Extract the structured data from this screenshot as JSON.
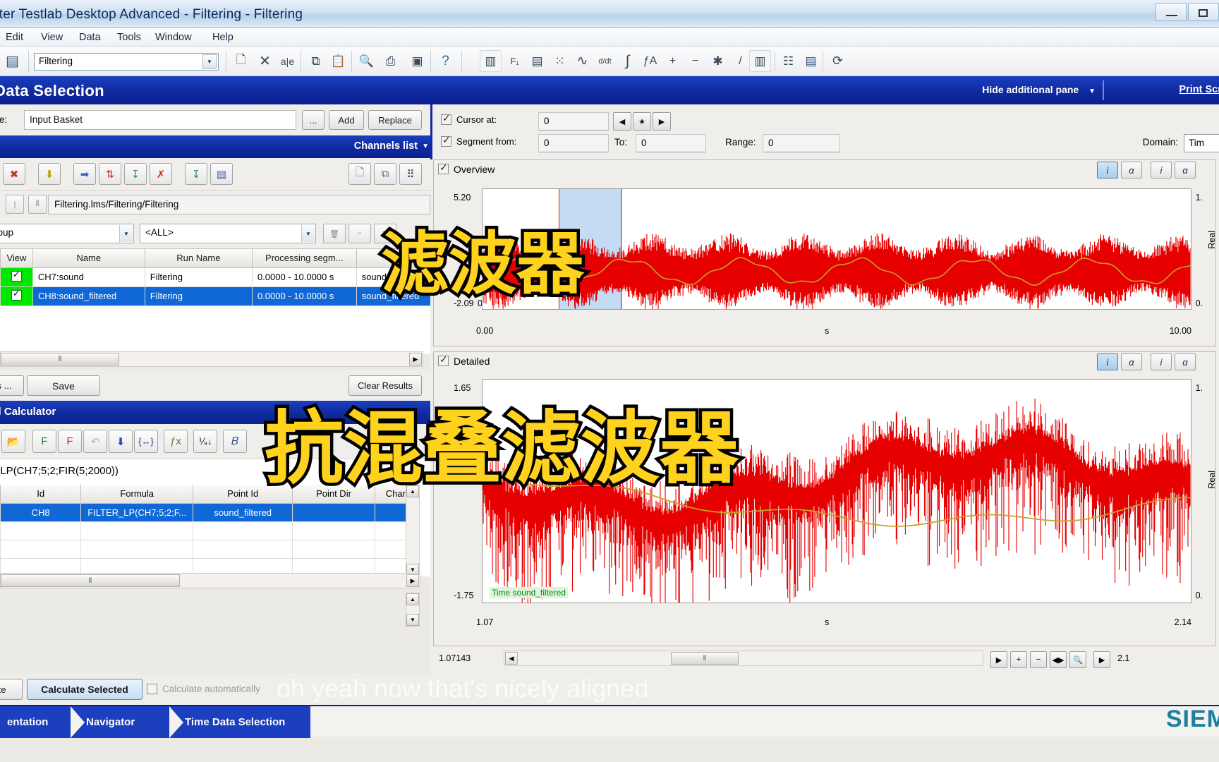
{
  "window": {
    "title": "nter Testlab Desktop Advanced - Filtering - Filtering",
    "minimize": "—",
    "restore": "❐"
  },
  "menu": {
    "items": [
      "Edit",
      "View",
      "Data",
      "Tools",
      "Window",
      "Help"
    ]
  },
  "toolbar": {
    "project_combo_value": "Filtering",
    "icons": [
      {
        "name": "save-icon",
        "glyph": "💾"
      },
      {
        "name": "new-document-icon",
        "glyph": "📄"
      },
      {
        "name": "delete-x-icon",
        "glyph": "✕"
      },
      {
        "name": "rename-icon",
        "glyph": "a|e"
      },
      {
        "name": "copy-icon",
        "glyph": "⧉"
      },
      {
        "name": "paste-icon",
        "glyph": "📋"
      },
      {
        "name": "print-preview-icon",
        "glyph": "🔍"
      },
      {
        "name": "print-icon",
        "glyph": "⎙"
      },
      {
        "name": "layout-icon",
        "glyph": "▣"
      },
      {
        "name": "help-icon",
        "glyph": "?"
      },
      {
        "name": "fft-icon",
        "glyph": "⬚"
      },
      {
        "name": "frf-icon",
        "glyph": "F₁"
      },
      {
        "name": "octave-icon",
        "glyph": "▒"
      },
      {
        "name": "scatter-icon",
        "glyph": "∷"
      },
      {
        "name": "waveform-icon",
        "glyph": "∿"
      },
      {
        "name": "derivative-icon",
        "glyph": "d/dt"
      },
      {
        "name": "integral-icon",
        "glyph": "∫"
      },
      {
        "name": "function-icon",
        "glyph": "ƒA"
      },
      {
        "name": "plus-icon",
        "glyph": "+"
      },
      {
        "name": "minus-icon",
        "glyph": "−"
      },
      {
        "name": "asterisk-icon",
        "glyph": "✱"
      },
      {
        "name": "divide-icon",
        "glyph": "/"
      },
      {
        "name": "srs-icon",
        "glyph": "⬚"
      },
      {
        "name": "report-icon",
        "glyph": "☷"
      },
      {
        "name": "save-report-icon",
        "glyph": "💾"
      },
      {
        "name": "browser-icon",
        "glyph": "⟳"
      }
    ]
  },
  "data_selection": {
    "title": "Data Selection",
    "hide_pane_label": "Hide additional pane",
    "print_screen_label": "Print Scree",
    "source_label": "ce:",
    "source_value": "Input Basket",
    "ellipsis_label": "...",
    "add_label": "Add",
    "replace_label": "Replace"
  },
  "cursor_panel": {
    "cursor_label": "Cursor at:",
    "cursor_value": "0",
    "segment_label": "Segment from:",
    "segment_from": "0",
    "to_label": "To:",
    "to_value": "0",
    "range_label": "Range:",
    "range_value": "0",
    "prev_icon": "◀",
    "center_icon": "★",
    "next_icon": "▶",
    "domain_label": "Domain:",
    "domain_value": "Tim"
  },
  "channels": {
    "header": "Channels list",
    "path_value": "Filtering.lms/Filtering/Filtering",
    "group_value": "roup",
    "all_value": "<ALL>",
    "toolbar_icons": [
      {
        "name": "remove-channel-icon",
        "glyph": "✖"
      },
      {
        "name": "import-down-icon",
        "glyph": "↓"
      },
      {
        "name": "move-right-icon",
        "glyph": "➡"
      },
      {
        "name": "swap-icon",
        "glyph": "⇅"
      },
      {
        "name": "add-to-display-icon",
        "glyph": "↧"
      },
      {
        "name": "remove-display-icon",
        "glyph": "✗"
      },
      {
        "name": "insert-icon",
        "glyph": "↧"
      },
      {
        "name": "save-channels-icon",
        "glyph": "💾"
      },
      {
        "name": "copy-list-icon",
        "glyph": "📄"
      },
      {
        "name": "duplicate-icon",
        "glyph": "⧉"
      },
      {
        "name": "grid-view-icon",
        "glyph": "∷"
      }
    ],
    "columns": [
      "View",
      "Name",
      "Run Name",
      "Processing segm...",
      "DOF id"
    ],
    "rows": [
      {
        "view": "✓",
        "name": "CH7:sound",
        "run": "Filtering",
        "segment": "0.0000 - 10.0000 s",
        "dof": "sound"
      },
      {
        "view": "✓",
        "name": "CH8:sound_filtered",
        "run": "Filtering",
        "segment": "0.0000 - 10.0000 s",
        "dof": "sound_filtered"
      }
    ]
  },
  "save_bar": {
    "save_as_label": "s ...",
    "save_label": "Save",
    "clear_results_label": "Clear Results"
  },
  "calculator": {
    "header": "nal Calculator",
    "formula_text": "_LP(CH7;5;2;FIR(5;2000))",
    "toolbar_icons": [
      {
        "name": "open-folder-icon",
        "glyph": "📂"
      },
      {
        "name": "new-formula-icon",
        "glyph": "F"
      },
      {
        "name": "delete-formula-icon",
        "glyph": "F"
      },
      {
        "name": "undo-icon",
        "glyph": "↶"
      },
      {
        "name": "apply-down-icon",
        "glyph": "↓"
      },
      {
        "name": "braces-icon",
        "glyph": "{↔}"
      },
      {
        "name": "fx-function-icon",
        "glyph": "ƒx"
      },
      {
        "name": "sort-icon",
        "glyph": "↓"
      },
      {
        "name": "bold-b-icon",
        "glyph": "𝑩"
      }
    ],
    "columns": [
      "Id",
      "Formula",
      "Point Id",
      "Point Dir",
      "Chan"
    ],
    "rows": [
      {
        "id": "CH8",
        "formula": "FILTER_LP(CH7;5;2;F...",
        "point_id": "sound_filtered",
        "point_dir": "",
        "chan": ""
      }
    ]
  },
  "action_bar": {
    "calculate_label": "te",
    "calculate_selected_label": "Calculate Selected",
    "auto_label": "Calculate automatically"
  },
  "nav_bar": {
    "items": [
      "entation",
      "Navigator",
      "Time Data Selection"
    ],
    "brand": "SIEM"
  },
  "overlay": {
    "caption_top": "滤波器",
    "caption_bottom": "抗混叠滤波器",
    "subtitle": "oh yeah now that's nicely aligned"
  },
  "chart_data": [
    {
      "type": "line",
      "name": "overview",
      "title": "Overview",
      "xlabel": "s",
      "ylabel": "Real",
      "xlim": [
        0.0,
        10.0
      ],
      "ylim": [
        -2.09,
        5.2
      ],
      "xticks": [
        "0.00",
        "10.00"
      ],
      "yticks": [
        "5.20",
        "-2.09"
      ],
      "x_origin_label": "0.00",
      "right_axis_ticks": [
        "1.",
        "0."
      ],
      "right_axis_label": "Real",
      "grid": false,
      "legend": "",
      "series": [
        {
          "name": "Time sound",
          "color": "#e60000",
          "description": "broadband noisy waveform, amplitude envelope ~ +/-1.6"
        },
        {
          "name": "Time sound_filtered",
          "color": "#c9a227",
          "description": "low-pass filtered sinusoid ~0.5 Hz, amplitude ~0.45"
        }
      ],
      "selection_band": [
        1.07,
        2.14
      ]
    },
    {
      "type": "line",
      "name": "detailed",
      "title": "Detailed",
      "xlabel": "s",
      "ylabel": "Real",
      "xlim": [
        1.07,
        2.14
      ],
      "ylim": [
        -1.75,
        1.65
      ],
      "xticks": [
        "1.07",
        "2.14"
      ],
      "yticks": [
        "1.65",
        "-1.75"
      ],
      "right_axis_ticks": [
        "1.",
        "0."
      ],
      "right_axis_label": "Real",
      "grid": false,
      "legend": "Time sound_filtered",
      "scroll_value": "1.07143",
      "scroll_max": "2.1",
      "series": [
        {
          "name": "Time sound",
          "color": "#e60000",
          "description": "dense high-frequency noise spikes"
        },
        {
          "name": "Time sound_filtered",
          "color": "#c9a227",
          "description": "smooth low-frequency curve dipping to -0.5 near centre"
        }
      ]
    }
  ],
  "plot_controls": {
    "overview_tabs": [
      "i",
      "α",
      "i",
      "α"
    ],
    "detailed_tabs": [
      "i",
      "α",
      "i",
      "α"
    ],
    "bottom_buttons": [
      "▶",
      "+",
      "−",
      "◀▶",
      "🔍",
      "▶"
    ]
  }
}
